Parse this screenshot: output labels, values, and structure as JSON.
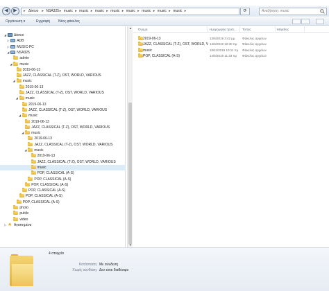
{
  "address": {
    "crumbs": [
      "Δίκτυο",
      "NSA325",
      "music",
      "music",
      "music",
      "music",
      "music",
      "music",
      "music",
      "music"
    ],
    "search_placeholder": "Αναζήτηση: music"
  },
  "toolbar": {
    "organize": "Οργάνωση ▾",
    "burn": "Εγγραφή",
    "new_folder": "Νέος φάκελος"
  },
  "nav": {
    "nodes": [
      {
        "label": "Δίκτυο",
        "icon": "network-icon",
        "indent": 0,
        "exp": "◢"
      },
      {
        "label": "ADB",
        "icon": "computer-icon",
        "indent": 1,
        "exp": "▷"
      },
      {
        "label": "MUSIC-PC",
        "icon": "computer-icon",
        "indent": 1,
        "exp": "▷"
      },
      {
        "label": "NSA325",
        "icon": "computer-icon",
        "indent": 1,
        "exp": "◢"
      },
      {
        "label": "admin",
        "icon": "folder-icon",
        "indent": 2,
        "exp": ""
      },
      {
        "label": "music",
        "icon": "folder-icon",
        "indent": 2,
        "exp": "◢"
      },
      {
        "label": "2019-06-13",
        "icon": "folder-icon",
        "indent": 3,
        "exp": ""
      },
      {
        "label": "JAZZ, CLASSICAL (T-Z), OST, WORLD, VARIOUS",
        "icon": "folder-icon",
        "indent": 3,
        "exp": ""
      },
      {
        "label": "music",
        "icon": "folder-icon",
        "indent": 3,
        "exp": "◢"
      },
      {
        "label": "2019-06-13",
        "icon": "folder-icon",
        "indent": 4,
        "exp": ""
      },
      {
        "label": "JAZZ, CLASSICAL (T-Z), OST, WORLD, VARIOUS",
        "icon": "folder-icon",
        "indent": 4,
        "exp": ""
      },
      {
        "label": "music",
        "icon": "folder-icon",
        "indent": 4,
        "exp": "◢"
      },
      {
        "label": "2019-06-13",
        "icon": "folder-icon",
        "indent": 5,
        "exp": ""
      },
      {
        "label": "JAZZ, CLASSICAL (T-Z), OST, WORLD, VARIOUS",
        "icon": "folder-icon",
        "indent": 5,
        "exp": ""
      },
      {
        "label": "music",
        "icon": "folder-icon",
        "indent": 5,
        "exp": "◢"
      },
      {
        "label": "2019-06-13",
        "icon": "folder-icon",
        "indent": 6,
        "exp": ""
      },
      {
        "label": "JAZZ, CLASSICAL (T-Z), OST, WORLD, VARIOUS",
        "icon": "folder-icon",
        "indent": 6,
        "exp": ""
      },
      {
        "label": "music",
        "icon": "folder-icon",
        "indent": 6,
        "exp": "◢"
      },
      {
        "label": "2019-06-13",
        "icon": "folder-icon",
        "indent": 7,
        "exp": ""
      },
      {
        "label": "JAZZ, CLASSICAL (T-Z), OST, WORLD, VARIOUS",
        "icon": "folder-icon",
        "indent": 7,
        "exp": ""
      },
      {
        "label": "music",
        "icon": "folder-icon",
        "indent": 7,
        "exp": "◢"
      },
      {
        "label": "2019-06-13",
        "icon": "folder-icon",
        "indent": 8,
        "exp": ""
      },
      {
        "label": "JAZZ, CLASSICAL (T-Z), OST, WORLD, VARIOUS",
        "icon": "folder-icon",
        "indent": 8,
        "exp": ""
      },
      {
        "label": "music",
        "icon": "folder-icon",
        "indent": 8,
        "exp": "",
        "selected": true
      },
      {
        "label": "POP, CLASSICAL (A-S)",
        "icon": "folder-icon",
        "indent": 8,
        "exp": ""
      },
      {
        "label": "POP, CLASSICAL (A-S)",
        "icon": "folder-icon",
        "indent": 7,
        "exp": ""
      },
      {
        "label": "POP, CLASSICAL (A-S)",
        "icon": "folder-icon",
        "indent": 6,
        "exp": ""
      },
      {
        "label": "POP, CLASSICAL (A-S)",
        "icon": "folder-icon",
        "indent": 5,
        "exp": ""
      },
      {
        "label": "POP, CLASSICAL (A-S)",
        "icon": "folder-icon",
        "indent": 4,
        "exp": ""
      },
      {
        "label": "POP, CLASSICAL (A-S)",
        "icon": "folder-icon",
        "indent": 3,
        "exp": ""
      },
      {
        "label": "photo",
        "icon": "folder-icon",
        "indent": 2,
        "exp": ""
      },
      {
        "label": "public",
        "icon": "folder-icon",
        "indent": 2,
        "exp": ""
      },
      {
        "label": "video",
        "icon": "folder-icon",
        "indent": 2,
        "exp": ""
      },
      {
        "label": "Αγαπημένα",
        "icon": "star-icon",
        "indent": 0,
        "exp": "▷"
      }
    ]
  },
  "list": {
    "headers": {
      "name": "Όνομα",
      "date": "Ημερομηνία τροπ...",
      "type": "Τύπος",
      "size": "Μέγεθος"
    },
    "rows": [
      {
        "name": "2019-06-13",
        "date": "13/6/2019 3:42 μμ",
        "type": "Φάκελος αρχείων"
      },
      {
        "name": "JAZZ, CLASSICAL (T-Z), OST, WORLD, VA...",
        "date": "14/6/2019 10:30 πμ",
        "type": "Φάκελος αρχείων"
      },
      {
        "name": "music",
        "date": "18/11/2019 10:11 πμ",
        "type": "Φάκελος αρχείων"
      },
      {
        "name": "POP, CLASSICAL (A-S)",
        "date": "14/6/2019 11:33 πμ",
        "type": "Φάκελος αρχείων"
      }
    ]
  },
  "details": {
    "count": "4 στοιχεία",
    "state_label": "Κατάσταση:",
    "state_value": "Με σύνδεση",
    "offline_label": "Χωρίς σύνδεση:",
    "offline_value": "Δεν είναι διαθέσιμο"
  },
  "colors": {
    "selection": "#dcebf8",
    "folder": "#e6b73c"
  }
}
